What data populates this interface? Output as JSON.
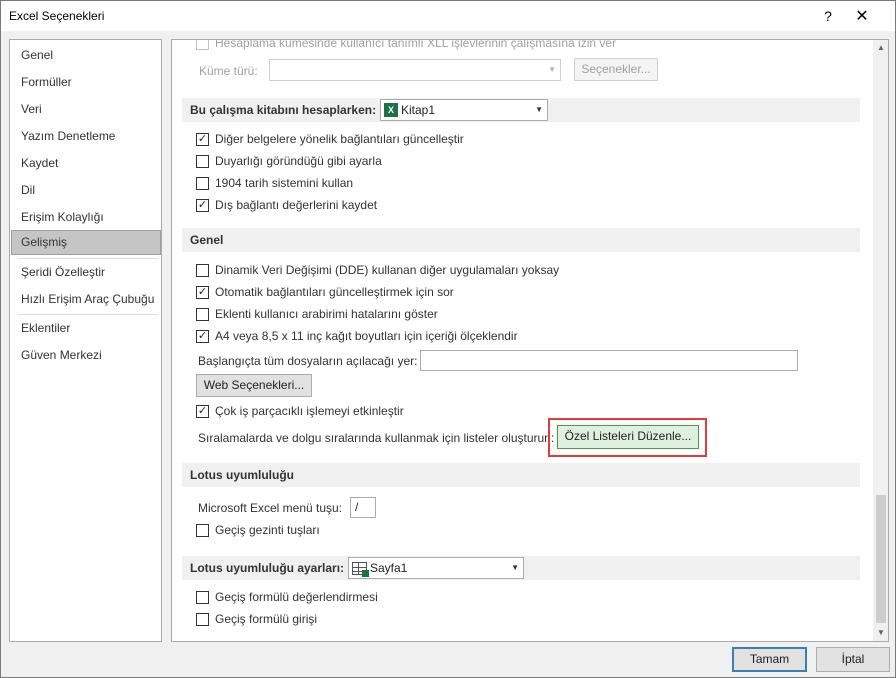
{
  "window": {
    "title": "Excel Seçenekleri",
    "help_label": "?",
    "close_label": "✕"
  },
  "sidebar": {
    "items": [
      {
        "label": "Genel"
      },
      {
        "label": "Formüller"
      },
      {
        "label": "Veri"
      },
      {
        "label": "Yazım Denetleme"
      },
      {
        "label": "Kaydet"
      },
      {
        "label": "Dil"
      },
      {
        "label": "Erişim Kolaylığı"
      },
      {
        "label": "Gelişmiş",
        "selected": true
      },
      {
        "label": "Şeridi Özelleştir"
      },
      {
        "label": "Hızlı Erişim Araç Çubuğu"
      },
      {
        "label": "Eklentiler"
      },
      {
        "label": "Güven Merkezi"
      }
    ]
  },
  "top": {
    "partial_option": "Hesaplama kümesinde kullanıcı tanımlı XLL işlevlerinin çalışmasına izin ver",
    "cube_type_label": "Küme türü:",
    "cube_type_value": "",
    "options_button": "Seçenekler..."
  },
  "workbook_section": {
    "title": "Bu çalışma kitabını hesaplarken:",
    "workbook": "Kitap1",
    "options": [
      {
        "label": "Diğer belgelere yönelik bağlantıları güncelleştir",
        "checked": true
      },
      {
        "label": "Duyarlığı göründüğü gibi ayarla",
        "checked": false
      },
      {
        "label": "1904 tarih sistemini kullan",
        "checked": false
      },
      {
        "label": "Dış bağlantı değerlerini kaydet",
        "checked": true
      }
    ]
  },
  "general_section": {
    "title": "Genel",
    "options": [
      {
        "label": "Dinamik Veri Değişimi (DDE) kullanan diğer uygulamaları yoksay",
        "checked": false
      },
      {
        "label": "Otomatik bağlantıları güncelleştirmek için sor",
        "checked": true
      },
      {
        "label": "Eklenti kullanıcı arabirimi hatalarını göster",
        "checked": false
      },
      {
        "label": "A4 veya 8,5 x 11 inç kağıt boyutları için içeriği ölçeklendir",
        "checked": true
      }
    ],
    "startup_label": "Başlangıçta tüm dosyaların açılacağı yer:",
    "startup_value": "",
    "web_options_button": "Web Seçenekleri...",
    "multithread_label": "Çok iş parçacıklı işlemeyi etkinleştir",
    "multithread_checked": true,
    "custom_lists_label": "Sıralamalarda ve dolgu sıralarında kullanmak için listeler oluşturun:",
    "custom_lists_button": "Özel Listeleri Düzenle..."
  },
  "lotus_section": {
    "title": "Lotus uyumluluğu",
    "menu_key_label": "Microsoft Excel menü tuşu:",
    "menu_key_value": "/",
    "nav_keys_label": "Geçiş gezinti tuşları",
    "nav_keys_checked": false
  },
  "lotus_settings_section": {
    "title": "Lotus uyumluluğu ayarları:",
    "sheet": "Sayfa1",
    "options": [
      {
        "label": "Geçiş formülü değerlendirmesi",
        "checked": false
      },
      {
        "label": "Geçiş formülü girişi",
        "checked": false
      }
    ]
  },
  "footer": {
    "ok": "Tamam",
    "cancel": "İptal"
  },
  "check_glyph": "✓",
  "arrow_glyph": "▼",
  "up_glyph": "▲"
}
